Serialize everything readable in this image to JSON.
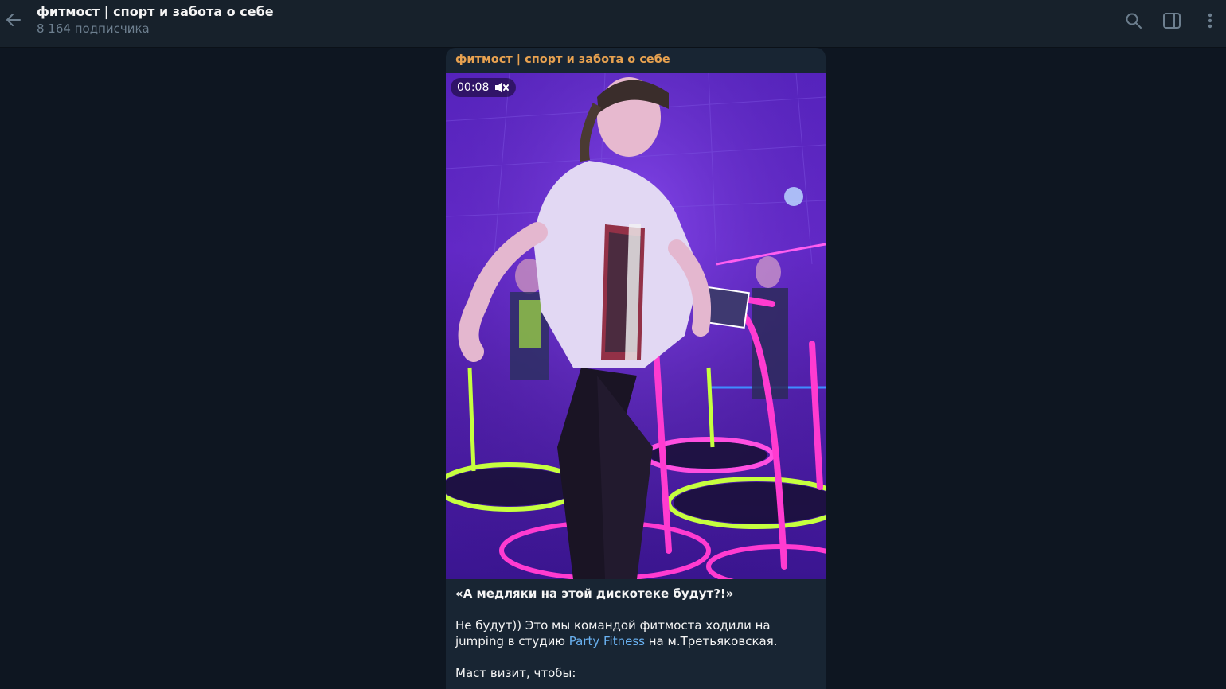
{
  "header": {
    "title": "фитмост | спорт и забота о себе",
    "subtitle": "8 164 подписчика",
    "icons": [
      "arrow-left-icon",
      "search-icon",
      "sidebar-toggle-icon",
      "more-vertical-icon"
    ]
  },
  "post": {
    "author": "фитмост | спорт и забота о себе",
    "video": {
      "duration": "00:08",
      "muted": true
    },
    "caption": {
      "headline": "«А медляки на этой дискотеке будут?!»",
      "para1_before": "Не будут)) Это мы командой фитмоста ходили на jumping в студию ",
      "link_text": "Party Fitness",
      "para1_after": " на м.Третьяковская.",
      "para2": "Маст визит, чтобы:"
    }
  },
  "colors": {
    "app_bg": "#0e1621",
    "header_bg": "#17212b",
    "bubble_bg": "#182533",
    "author": "#e8a250",
    "link": "#6ab2f2",
    "muted_text": "#6d7f8f"
  }
}
